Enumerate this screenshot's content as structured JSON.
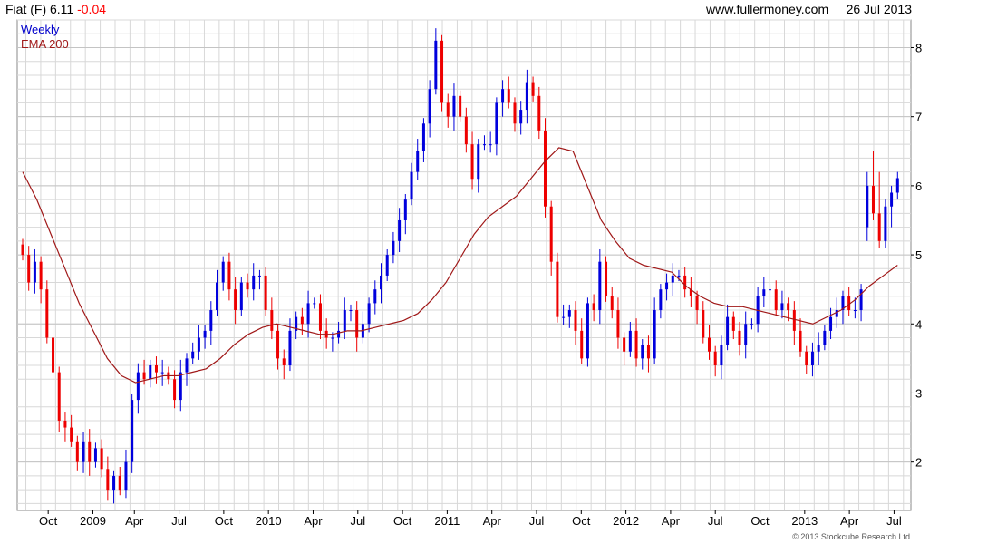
{
  "header": {
    "name": "Fiat (F)",
    "price": "6.11",
    "change": "-0.04",
    "website": "www.fullermoney.com",
    "date": "26 Jul 2013"
  },
  "colors": {
    "up": "#0000dd",
    "down": "#ee0000",
    "ema": "#a01818",
    "grid": "#d8d8d8",
    "negative": "#ff0000"
  },
  "footer": {
    "copyright": "© 2013 Stockcube Research Ltd"
  },
  "chart_data": {
    "type": "candlestick",
    "legend": [
      {
        "label": "Weekly",
        "color": "#0000cc"
      },
      {
        "label": "EMA 200",
        "color": "#a01818"
      }
    ],
    "legend_placement": "top-left",
    "y_axis_side": "right",
    "grid": true,
    "ylim": [
      1.3,
      8.4
    ],
    "yticks": [
      2,
      3,
      4,
      5,
      6,
      7,
      8
    ],
    "xlim": [
      0,
      138
    ],
    "xticks": [
      {
        "label": "Oct",
        "x": 4
      },
      {
        "label": "2009",
        "x": 11
      },
      {
        "label": "Apr",
        "x": 17.5
      },
      {
        "label": "Jul",
        "x": 24.5
      },
      {
        "label": "Oct",
        "x": 31.5
      },
      {
        "label": "2010",
        "x": 38.5
      },
      {
        "label": "Apr",
        "x": 45.5
      },
      {
        "label": "Jul",
        "x": 52.5
      },
      {
        "label": "Oct",
        "x": 59.5
      },
      {
        "label": "2011",
        "x": 66.5
      },
      {
        "label": "Apr",
        "x": 73.5
      },
      {
        "label": "Jul",
        "x": 80.5
      },
      {
        "label": "Oct",
        "x": 87.5
      },
      {
        "label": "2012",
        "x": 94.5
      },
      {
        "label": "Apr",
        "x": 101.5
      },
      {
        "label": "Jul",
        "x": 108.5
      },
      {
        "label": "Oct",
        "x": 115.5
      },
      {
        "label": "2013",
        "x": 122.5
      },
      {
        "label": "Apr",
        "x": 129.5
      },
      {
        "label": "Jul",
        "x": 136.5
      }
    ],
    "weekly_close": [
      5.0,
      4.6,
      4.9,
      4.5,
      3.8,
      3.3,
      2.6,
      2.5,
      2.3,
      2.0,
      2.3,
      2.0,
      2.2,
      1.9,
      1.6,
      1.8,
      1.6,
      2.0,
      2.9,
      3.3,
      3.2,
      3.4,
      3.3,
      3.3,
      3.2,
      2.9,
      3.3,
      3.5,
      3.6,
      3.8,
      3.9,
      4.2,
      4.6,
      4.9,
      4.5,
      4.2,
      4.6,
      4.5,
      4.7,
      4.7,
      4.2,
      3.9,
      3.5,
      3.4,
      3.9,
      4.1,
      4.0,
      4.3,
      4.3,
      3.9,
      3.8,
      3.8,
      3.9,
      4.2,
      4.2,
      3.8,
      4.0,
      4.3,
      4.5,
      4.7,
      5.0,
      5.2,
      5.5,
      5.8,
      6.2,
      6.5,
      6.9,
      7.4,
      8.1,
      7.2,
      7.0,
      7.3,
      7.0,
      6.6,
      6.1,
      6.6,
      6.6,
      6.6,
      7.2,
      7.4,
      7.2,
      6.9,
      7.1,
      7.5,
      7.3,
      6.8,
      5.7,
      4.9,
      4.1,
      4.1,
      4.2,
      3.9,
      3.5,
      4.3,
      4.2,
      4.9,
      4.4,
      4.2,
      3.8,
      3.6,
      3.9,
      3.5,
      3.7,
      3.5,
      4.2,
      4.5,
      4.6,
      4.7,
      4.7,
      4.5,
      4.4,
      4.2,
      3.8,
      3.6,
      3.4,
      3.7,
      4.1,
      3.9,
      3.7,
      4.0,
      4.0,
      4.4,
      4.5,
      4.5,
      4.2,
      4.3,
      4.2,
      3.9,
      3.6,
      3.4,
      3.6,
      3.7,
      3.9,
      4.1,
      4.2,
      4.4,
      4.2,
      4.2,
      4.5
    ],
    "ema_200": [
      6.2,
      5.8,
      5.3,
      4.8,
      4.3,
      3.9,
      3.5,
      3.25,
      3.15,
      3.2,
      3.25,
      3.25,
      3.3,
      3.35,
      3.5,
      3.7,
      3.85,
      3.95,
      4.0,
      3.95,
      3.9,
      3.85,
      3.85,
      3.9,
      3.9,
      3.95,
      4.0,
      4.05,
      4.15,
      4.35,
      4.6,
      4.95,
      5.3,
      5.55,
      5.7,
      5.85,
      6.1,
      6.35,
      6.55,
      6.5,
      6.0,
      5.5,
      5.2,
      4.95,
      4.85,
      4.8,
      4.75,
      4.55,
      4.4,
      4.3,
      4.25,
      4.25,
      4.2,
      4.15,
      4.1,
      4.05,
      4.0,
      4.1,
      4.2,
      4.35,
      4.55,
      4.7,
      4.85
    ],
    "ohlc_last_weeks": [
      {
        "week": "2013-05",
        "open": 5.4,
        "high": 6.2,
        "low": 5.2,
        "close": 6.0
      },
      {
        "week": "2013-05b",
        "open": 6.0,
        "high": 6.5,
        "low": 5.5,
        "close": 5.6
      },
      {
        "week": "2013-06",
        "open": 5.6,
        "high": 6.2,
        "low": 5.1,
        "close": 5.2
      },
      {
        "week": "2013-06b",
        "open": 5.2,
        "high": 5.8,
        "low": 5.1,
        "close": 5.7
      },
      {
        "week": "2013-07",
        "open": 5.7,
        "high": 6.0,
        "low": 5.4,
        "close": 5.9
      },
      {
        "week": "2013-07b",
        "open": 5.9,
        "high": 6.2,
        "low": 5.8,
        "close": 6.11
      }
    ]
  }
}
